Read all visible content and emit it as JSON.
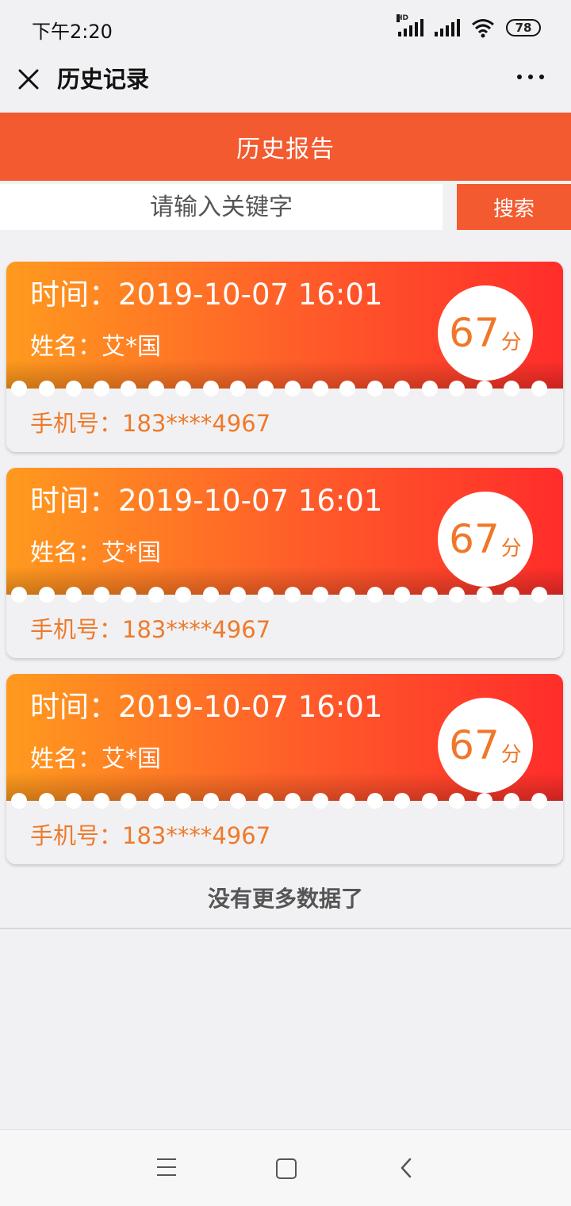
{
  "status_bar": {
    "time": "下午2:20",
    "battery": "78",
    "hd": "HD"
  },
  "header": {
    "title": "历史记录"
  },
  "report": {
    "title": "历史报告"
  },
  "search": {
    "placeholder": "请输入关键字",
    "button_label": "搜索"
  },
  "records": [
    {
      "time": "时间：2019-10-07 16:01",
      "name": "姓名：艾*国",
      "score": "67",
      "score_unit": "分",
      "phone": "手机号：183****4967"
    },
    {
      "time": "时间：2019-10-07 16:01",
      "name": "姓名：艾*国",
      "score": "67",
      "score_unit": "分",
      "phone": "手机号：183****4967"
    },
    {
      "time": "时间：2019-10-07 16:01",
      "name": "姓名：艾*国",
      "score": "67",
      "score_unit": "分",
      "phone": "手机号：183****4967"
    }
  ],
  "footer": {
    "no_more": "没有更多数据了"
  },
  "colors": {
    "accent": "#f35a2f",
    "card_start": "#ff9a1e",
    "card_end": "#ff2d2a",
    "score_text": "#f0772a",
    "phone_text": "#ee7a2b"
  },
  "icons": [
    "close-icon",
    "more-icon",
    "signal-icon",
    "wifi-icon",
    "battery-icon",
    "menu-icon",
    "home-icon",
    "back-icon"
  ]
}
